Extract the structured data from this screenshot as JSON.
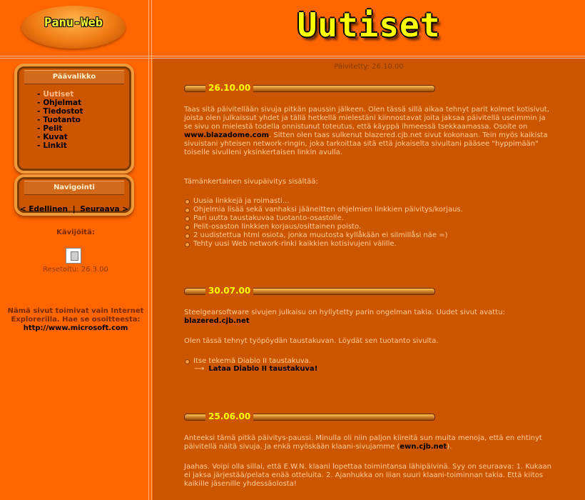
{
  "header": {
    "logo_text": "Panu-Web",
    "page_title": "Uutiset"
  },
  "sidebar": {
    "main_menu": {
      "title": "Päävalikko",
      "items": [
        {
          "label": "Uutiset",
          "active": true
        },
        {
          "label": "Ohjelmat"
        },
        {
          "label": "Tiedostot"
        },
        {
          "label": "Tuotanto"
        },
        {
          "label": "Pelit"
        },
        {
          "label": "Kuvat"
        },
        {
          "label": "Linkit"
        }
      ]
    },
    "navigation": {
      "title": "Navigointi",
      "prev_label": "< Edellinen",
      "separator": "|",
      "next_label": "Seuraava >"
    },
    "visitors_label": "Kävijöitä:",
    "counter_icon": "broken-image-icon",
    "reset_text": "Resetoitu: 26.3.00",
    "browser_note_line1": "Nämä sivut toimivat vain Internet",
    "browser_note_line2": "Explorerilla. Hae se osoitteesta:",
    "browser_note_url": "http://www.microsoft.com"
  },
  "main": {
    "updated_text": "Päivitetty: 26.10.00",
    "posts": [
      {
        "date": "26.10.00",
        "p1_a": "Taas sitä päivitellään sivuja pitkän paussin jälkeen. Olen tässä sillä aikaa tehnyt parit kolmet kotisivut, joista olen julkaissut yhdet ja tällä hetkellä mielestäni kiinnostavat joita jaksaa päivitellä useimmin ja se sivu on mielestä todella onnistunut toteutus, että käyppä ihmeessä tsekkaamassa. Osoite on ",
        "p1_link": "www.blazadome.com",
        "p1_b": ". Sitten olen taas sulkenut blazered.cjb.net sivut kokonaan. Tein myös kaikista sivuistani yhteisen network-ringin, joka tarkoittaa sitä että jokaiselta sivultani pääsee \"hyppimään\" toiselle sivulleni yksinkertaisen linkin avulla.",
        "p2": "Tämänkertainen sivupäivitys sisältää:",
        "bullets": [
          "Uusia linkkejä ja roimasti...",
          "Ohjelmia lisää sekä vanhaksi jääneitten ohjelmien linkkien päivitys/korjaus.",
          "Pari uutta taustakuvaa tuotanto-osastolle.",
          "Pelit-osaston linkkien korjaus/osittainen poisto.",
          "2 uudistettua html osiota, jonka muutosta kyllåkään ei silmillåsi näe =)",
          "Tehty uusi Web network-rinki kaikkien kotisivujeni välille."
        ]
      },
      {
        "date": "30.07.00",
        "p1": "Steelgearsoftware sivujen julkaisu on hyllytetty parin ongelman takia. Uudet sivut avattu:",
        "p1_link": "blazered.cjb.net",
        "p2": "Olen tässä tehnyt työpöydän taustakuvan. Löydät sen tuotanto sivulta.",
        "bullet": "Itse tekemä Diablo II taustakuva.",
        "download_link": "Lataa Diablo II taustakuva!",
        "arrow_icon": "right-arrow-icon"
      },
      {
        "date": "25.06.00",
        "p1_a": "Anteeksi tämä pitkä päivitys-paussi. Minulla oli niin paljon kiireitä sun muita menoja, että en ehtinyt päivitellä näitä sivuja. Ja enkä myöskään klaani-sivujamme (",
        "p1_link": "ewn.cjb.net",
        "p1_b": ").",
        "p2": "Jaahas. Voipi olla sillai, että E.W.N. klaani lopettaa toimintansa lähipäivinä. Syy on seuraava: 1. Kukaan ei jaksa järjestää/pelata enää otteluita. 2. Ajanhukka on liian suuri klaani-toiminnan takia. Että kiitos kaikille jäsenille yhdessäolosta!"
      }
    ]
  }
}
